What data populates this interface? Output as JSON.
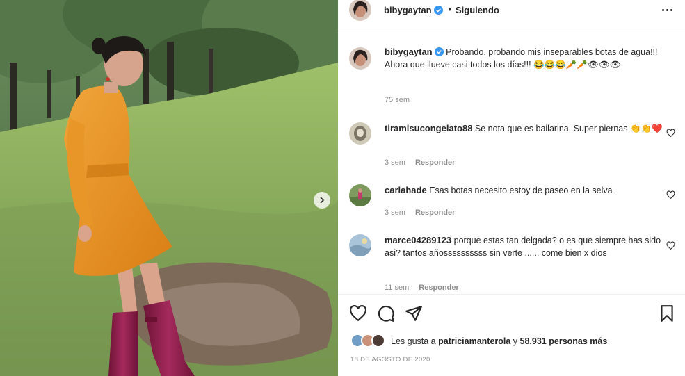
{
  "post": {
    "author": "bibygaytan",
    "follow_status": "Siguiendo",
    "separator": "•",
    "caption": "Probando, probando mis inseparables botas de agua!!! Ahora que llueve casi todos los días!!! 😂😂😂🥕🥕👁👁👁",
    "caption_age": "75 sem"
  },
  "comments": [
    {
      "user": "tiramisucongelato88",
      "text": "Se nota que es bailarina. Super piernas 👏👏❤️",
      "age": "3 sem",
      "reply": "Responder"
    },
    {
      "user": "carlahade",
      "text": "Esas botas necesito estoy de paseo en la selva",
      "age": "3 sem",
      "reply": "Responder"
    },
    {
      "user": "marce04289123",
      "text": "porque estas tan delgada? o es que siempre has sido asi? tantos añossssssssss sin verte ...... come bien x dios",
      "age": "11 sem",
      "reply": "Responder"
    }
  ],
  "likes": {
    "prefix": "Les gusta a ",
    "user": "patriciamanterola",
    "middle": " y ",
    "count": "58.931 personas más"
  },
  "date": "18 DE AGOSTO DE 2020",
  "icons": {
    "more": "more-options-icon",
    "like": "heart-icon",
    "comment": "comment-icon",
    "share": "share-icon",
    "save": "bookmark-icon",
    "next": "chevron-right-icon",
    "verified": "verified-badge-icon"
  },
  "colors": {
    "verified": "#3897f0",
    "text": "#262626",
    "secondary": "#8e8e8e",
    "dress": "#e8941f",
    "boots": "#8a1f4a"
  }
}
